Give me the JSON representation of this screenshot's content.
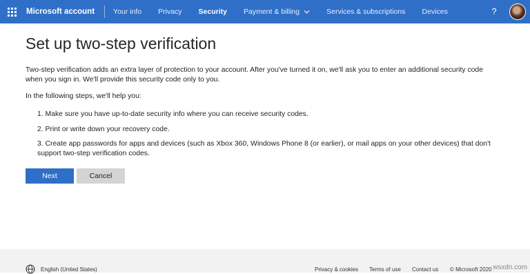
{
  "header": {
    "brand": "Microsoft account",
    "nav": [
      {
        "label": "Your info",
        "active": false
      },
      {
        "label": "Privacy",
        "active": false
      },
      {
        "label": "Security",
        "active": true
      },
      {
        "label": "Payment & billing",
        "active": false,
        "has_dropdown": true
      },
      {
        "label": "Services & subscriptions",
        "active": false
      },
      {
        "label": "Devices",
        "active": false
      }
    ],
    "help_label": "?",
    "accent_color": "#2f6fc7"
  },
  "main": {
    "title": "Set up two-step verification",
    "intro": "Two-step verification adds an extra layer of protection to your account. After you've turned it on, we'll ask you to enter an additional security code when you sign in. We'll provide this security code only to you.",
    "steps_lead": "In the following steps, we'll help you:",
    "steps": [
      "1. Make sure you have up-to-date security info where you can receive security codes.",
      "2. Print or write down your recovery code.",
      "3. Create app passwords for apps and devices (such as Xbox 360, Windows Phone 8 (or earlier), or mail apps on your other devices) that don't support two-step verification codes."
    ],
    "next_label": "Next",
    "cancel_label": "Cancel"
  },
  "footer": {
    "language": "English (United States)",
    "links": [
      "Privacy & cookies",
      "Terms of use",
      "Contact us",
      "© Microsoft 2020"
    ]
  },
  "watermark": "wsxdn.com"
}
